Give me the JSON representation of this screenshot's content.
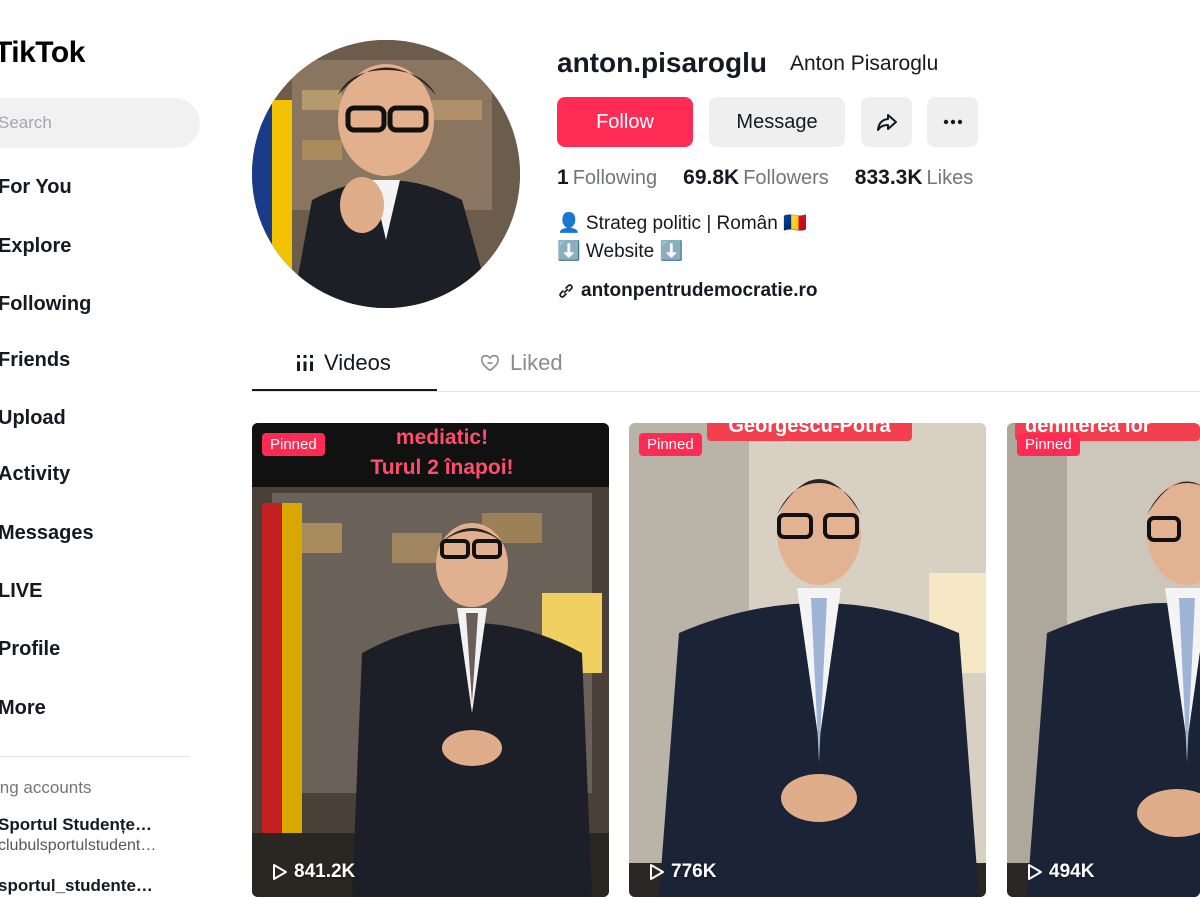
{
  "app": {
    "logo": "TikTok"
  },
  "sidebar": {
    "search_placeholder": "Search",
    "items": [
      {
        "label": "For You"
      },
      {
        "label": "Explore"
      },
      {
        "label": "Following"
      },
      {
        "label": "Friends"
      },
      {
        "label": "Upload"
      },
      {
        "label": "Activity"
      },
      {
        "label": "Messages"
      },
      {
        "label": "LIVE"
      },
      {
        "label": "Profile"
      },
      {
        "label": "More"
      }
    ],
    "following_title": "ing accounts",
    "accounts": [
      {
        "name": "Sportul Studențe…",
        "handle": "clubulsportulstudent…"
      },
      {
        "name": "sportul_studente…",
        "handle": ""
      }
    ]
  },
  "profile": {
    "username": "anton.pisaroglu",
    "nickname": "Anton Pisaroglu",
    "follow_label": "Follow",
    "message_label": "Message",
    "stats": [
      {
        "value": "1",
        "label": "Following"
      },
      {
        "value": "69.8K",
        "label": "Followers"
      },
      {
        "value": "833.3K",
        "label": "Likes"
      }
    ],
    "bio_line1": "👤 Strateg politic | Român 🇷🇴",
    "bio_line2": "⬇️ Website ⬇️",
    "link": "antonpentrudemocratie.ro"
  },
  "tabs": [
    {
      "label": "Videos",
      "active": true
    },
    {
      "label": "Liked",
      "active": false
    }
  ],
  "videos": [
    {
      "pinned": "Pinned",
      "caption": "mediatic!\nTurul 2 înapoi!",
      "views": "841.2K"
    },
    {
      "pinned": "Pinned",
      "caption": "Georgescu-Potra",
      "views": "776K"
    },
    {
      "pinned": "Pinned",
      "caption": "demiterea lor",
      "views": "494K"
    }
  ],
  "colors": {
    "accent": "#fe2c55",
    "text": "#161823",
    "muted": "#73757c",
    "button_bg": "#efeff0"
  },
  "icons": [
    "search-icon",
    "share-icon",
    "more-icon",
    "link-icon",
    "grid-icon",
    "heart-icon",
    "play-icon"
  ]
}
